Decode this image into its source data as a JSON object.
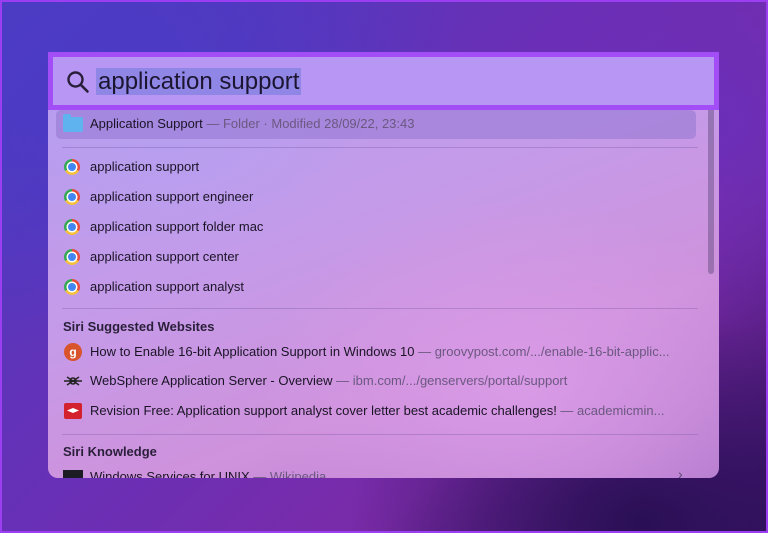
{
  "search": {
    "query": "application support",
    "icon": "magnifying-glass-icon"
  },
  "top_hit": {
    "title": "Application Support",
    "meta": " — Folder · Modified 28/09/22, 23:43",
    "icon": "folder-icon"
  },
  "suggestions": [
    {
      "label": "application support",
      "icon": "chrome-icon"
    },
    {
      "label": "application support engineer",
      "icon": "chrome-icon"
    },
    {
      "label": "application support folder mac",
      "icon": "chrome-icon"
    },
    {
      "label": "application support center",
      "icon": "chrome-icon"
    },
    {
      "label": "application support analyst",
      "icon": "chrome-icon"
    }
  ],
  "siri_websites": {
    "heading": "Siri Suggested Websites",
    "items": [
      {
        "title": "How to Enable 16-bit Application Support in Windows 10",
        "source": " — groovypost.com/.../enable-16-bit-applic...",
        "icon": "groovypost-icon",
        "icon_text": "g"
      },
      {
        "title": "WebSphere Application Server - Overview",
        "source": " — ibm.com/.../genservers/portal/support",
        "icon": "ibm-icon"
      },
      {
        "title": "Revision Free: Application support analyst cover letter best academic challenges!",
        "source": " — academicmin...",
        "icon": "academic-icon"
      }
    ]
  },
  "siri_knowledge": {
    "heading": "Siri Knowledge",
    "items": [
      {
        "title": "Windows Services for UNIX",
        "source": " — Wikipedia",
        "icon": "unix-icon"
      }
    ]
  },
  "colors": {
    "highlight_border": "#a24df5",
    "selection": "#8f86e6"
  }
}
